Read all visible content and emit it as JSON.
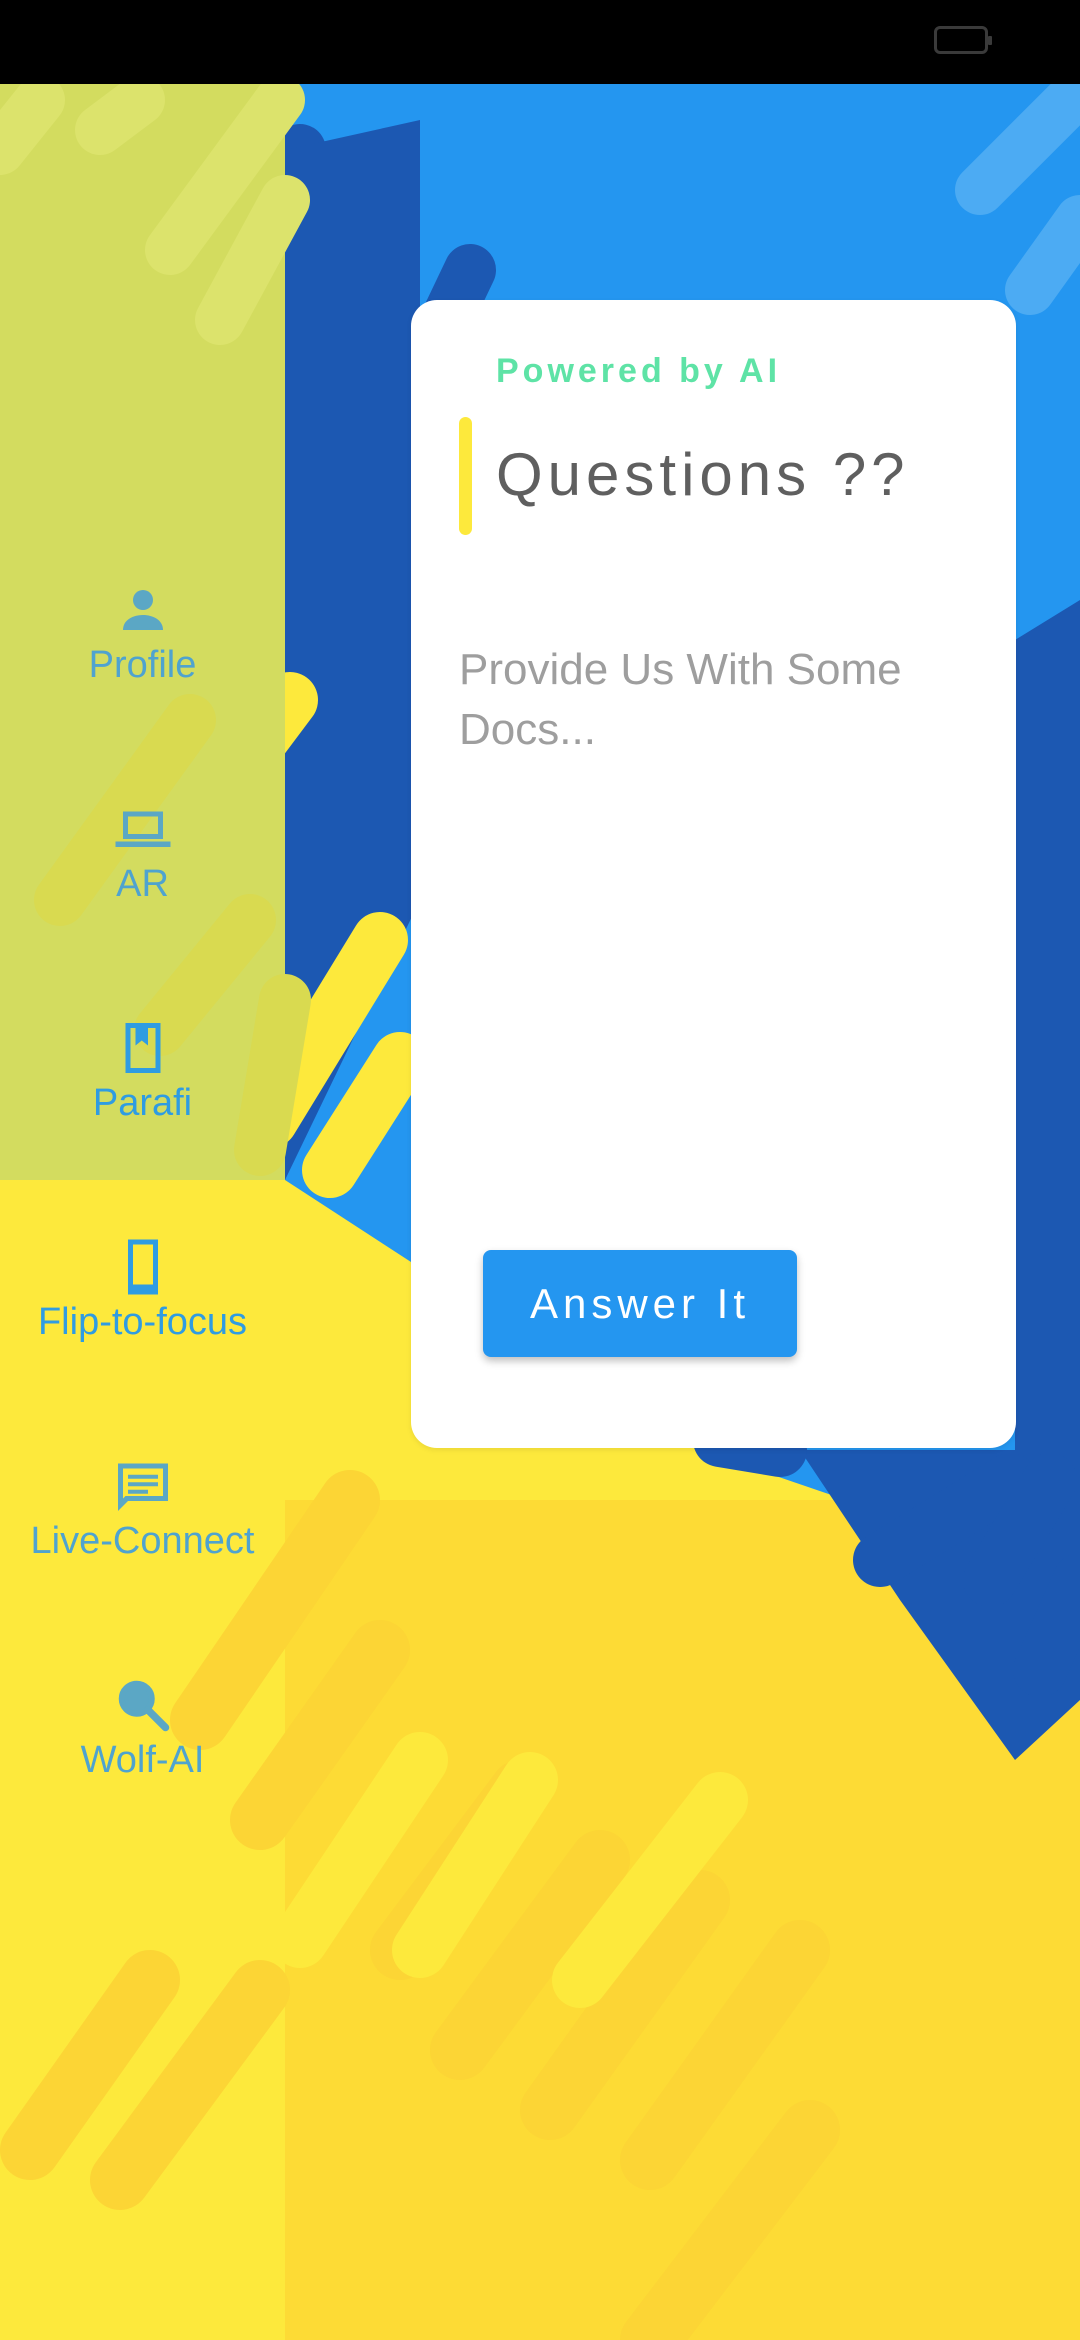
{
  "colors": {
    "blue": "#2496F0",
    "dark_blue": "#1C58B2",
    "yellow": "#FDE93C",
    "sidebar_overlay": "#D3DC5F",
    "green_accent": "#5EE3A6"
  },
  "sidebar": {
    "items": [
      {
        "label": "Profile",
        "icon": "person-icon"
      },
      {
        "label": "AR",
        "icon": "laptop-icon"
      },
      {
        "label": "Parafi",
        "icon": "book-icon"
      },
      {
        "label": "Flip-to-focus",
        "icon": "phone-icon"
      },
      {
        "label": "Live-Connect",
        "icon": "chat-icon"
      },
      {
        "label": "Wolf-AI",
        "icon": "search-icon"
      }
    ]
  },
  "card": {
    "kicker": "Powered by AI",
    "title": "Questions ??",
    "docs_placeholder": "Provide Us With Some Docs...",
    "docs_value": "",
    "answer_button": "Answer It"
  }
}
